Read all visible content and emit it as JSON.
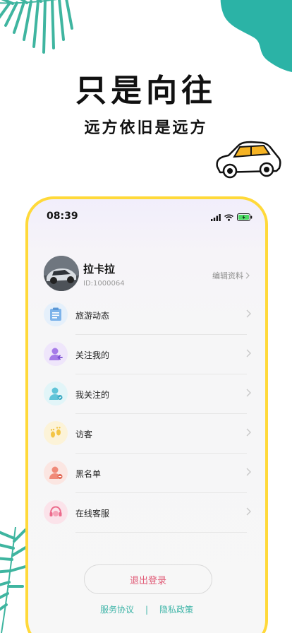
{
  "promo": {
    "headline": "只是向往",
    "subline": "远方依旧是远方"
  },
  "status_bar": {
    "time": "08:39",
    "icons": [
      "signal-icon",
      "wifi-icon",
      "battery-charging-icon"
    ]
  },
  "profile": {
    "name": "拉卡拉",
    "id_text": "ID:1000064",
    "edit_label": "编辑资料"
  },
  "menu": {
    "items": [
      {
        "label": "旅游动态",
        "icon": "clipboard-icon",
        "color": "#7db3ea",
        "bg": "#e5f0fb"
      },
      {
        "label": "关注我的",
        "icon": "user-follower-icon",
        "color": "#a67be8",
        "bg": "#efe6fb"
      },
      {
        "label": "我关注的",
        "icon": "user-following-icon",
        "color": "#5fc4d8",
        "bg": "#e2f5f8"
      },
      {
        "label": "访客",
        "icon": "footprints-icon",
        "color": "#f3c545",
        "bg": "#fcf3d8"
      },
      {
        "label": "黑名单",
        "icon": "user-block-icon",
        "color": "#f08a78",
        "bg": "#fbe6e2"
      },
      {
        "label": "在线客服",
        "icon": "headset-icon",
        "color": "#ec6b8c",
        "bg": "#fbe3ea"
      }
    ]
  },
  "logout_label": "退出登录",
  "links": {
    "terms": "服务协议",
    "separator": "|",
    "privacy": "隐私政策"
  },
  "colors": {
    "frame": "#ffd93a",
    "teal": "#2bb3a6",
    "logout_text": "#e05a76",
    "link_text": "#3fb5a8"
  }
}
